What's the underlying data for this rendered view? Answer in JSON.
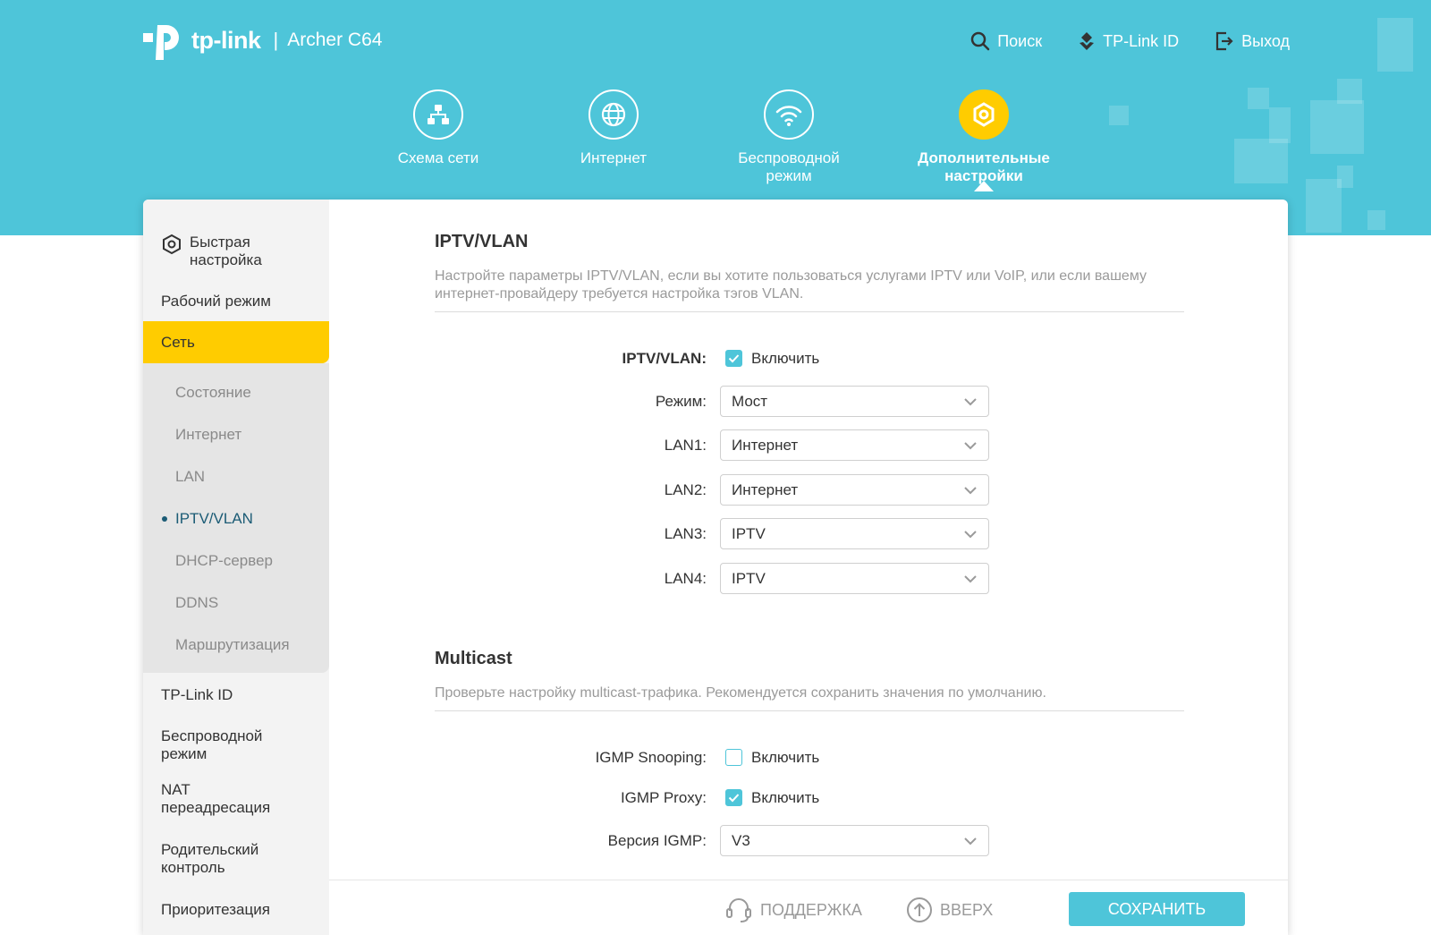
{
  "brand": {
    "logo_text": "tp-link",
    "separator": "|",
    "model": "Archer C64"
  },
  "top_actions": {
    "search": "Поиск",
    "tplink_id": "TP-Link ID",
    "logout": "Выход"
  },
  "nav": [
    {
      "label": "Схема сети",
      "icon": "network-map-icon"
    },
    {
      "label": "Интернет",
      "icon": "globe-icon"
    },
    {
      "label": "Беспроводной режим",
      "icon": "wifi-icon"
    },
    {
      "label": "Дополнительные настройки",
      "icon": "gear-icon",
      "active": true
    }
  ],
  "sidebar": {
    "items": [
      {
        "label": "Быстрая настройка"
      },
      {
        "label": "Рабочий режим"
      },
      {
        "label": "Сеть",
        "active": true
      },
      {
        "label": "TP-Link ID"
      },
      {
        "label": "Беспроводной режим"
      },
      {
        "label": "NAT переадресация"
      },
      {
        "label": "Родительский контроль"
      },
      {
        "label": "Приоритезация"
      }
    ],
    "sub_items": [
      {
        "label": "Состояние"
      },
      {
        "label": "Интернет"
      },
      {
        "label": "LAN"
      },
      {
        "label": "IPTV/VLAN",
        "active": true
      },
      {
        "label": "DHCP-сервер"
      },
      {
        "label": "DDNS"
      },
      {
        "label": "Маршрутизация"
      }
    ]
  },
  "iptv": {
    "title": "IPTV/VLAN",
    "description": "Настройте параметры IPTV/VLAN, если вы хотите пользоваться услугами IPTV или VoIP, или если вашему интернет-провайдеру требуется настройка тэгов VLAN.",
    "enable_label": "IPTV/VLAN:",
    "enable_text": "Включить",
    "enabled": true,
    "mode_label": "Режим:",
    "mode_value": "Мост",
    "lan1_label": "LAN1:",
    "lan1_value": "Интернет",
    "lan2_label": "LAN2:",
    "lan2_value": "Интернет",
    "lan3_label": "LAN3:",
    "lan3_value": "IPTV",
    "lan4_label": "LAN4:",
    "lan4_value": "IPTV"
  },
  "multicast": {
    "title": "Multicast",
    "description": "Проверьте настройку multicast-трафика. Рекомендуется сохранить значения по умолчанию.",
    "igmp_snooping_label": "IGMP Snooping:",
    "igmp_snooping_text": "Включить",
    "igmp_snooping_enabled": false,
    "igmp_proxy_label": "IGMP Proxy:",
    "igmp_proxy_text": "Включить",
    "igmp_proxy_enabled": true,
    "igmp_version_label": "Версия IGMP:",
    "igmp_version_value": "V3"
  },
  "footer": {
    "support": "ПОДДЕРЖКА",
    "top": "ВВЕРХ",
    "save": "СОХРАНИТЬ"
  },
  "colors": {
    "accent": "#4ec5d9",
    "highlight": "#ffcc00",
    "active_sub": "#1b5b75"
  }
}
